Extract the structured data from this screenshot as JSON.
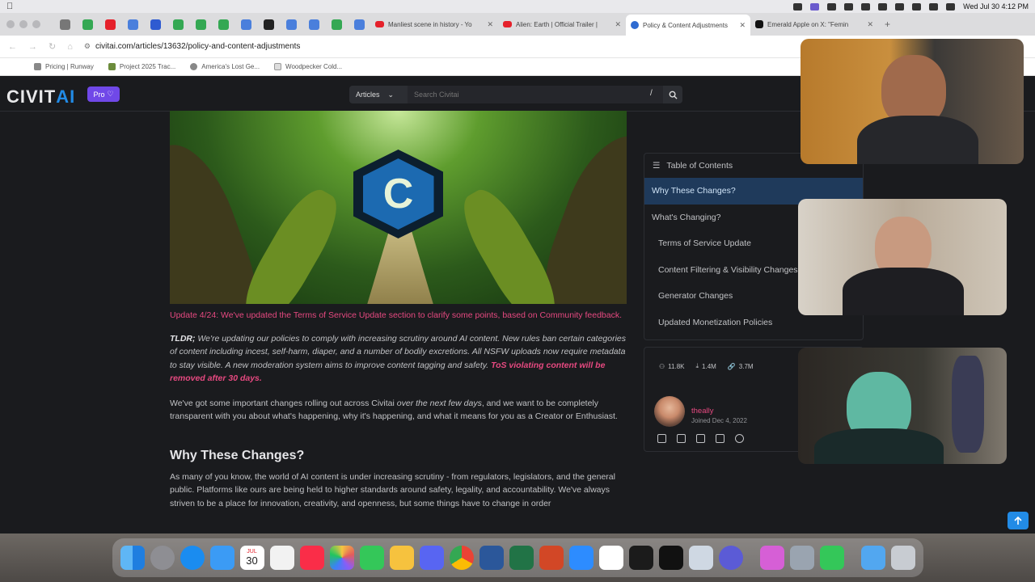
{
  "menubar": {
    "clock": "Wed Jul 30  4:12 PM"
  },
  "tabs": [
    {
      "title": "Manliest scene in history - Yo",
      "favicon_color": "#e5212b"
    },
    {
      "title": "Alien: Earth | Official Trailer |",
      "favicon_color": "#e5212b"
    },
    {
      "title": "Policy & Content Adjustments",
      "favicon_color": "#2f6bd1",
      "active": true
    },
    {
      "title": "Emerald Apple on X: \"Femin",
      "favicon_color": "#111111"
    }
  ],
  "address_bar": {
    "url": "civitai.com/articles/13632/policy-and-content-adjustments"
  },
  "bookmarks": [
    {
      "label": "Pricing | Runway"
    },
    {
      "label": "Project 2025 Trac..."
    },
    {
      "label": "America's Lost Ge..."
    },
    {
      "label": "Woodpecker Cold..."
    }
  ],
  "site": {
    "logo_main": "CIVIT",
    "logo_accent": "AI",
    "pro_label": "Pro",
    "search_category": "Articles",
    "search_placeholder": "Search Civitai",
    "search_shortcut": "/"
  },
  "article": {
    "update_note": "Update 4/24: We've updated the Terms of Service Update section to clarify some points, based on Community feedback.",
    "tldr_label": "TLDR;",
    "tldr_body": " We're updating our policies to comply with increasing scrutiny around AI content. New rules ban certain categories of content including incest, self-harm, diaper, and a number of bodily excretions. All NSFW uploads now require metadata to stay visible. A new moderation system aims to improve content tagging and safety. ",
    "tldr_warning": "ToS violating content will be removed after 30 days.",
    "intro_before": "We've got some important changes rolling out across Civitai ",
    "intro_italic": "over the next few days",
    "intro_after": ", and we want to be completely transparent with you about what's happening, why it's happening, and what it means for you as a Creator or Enthusiast.",
    "heading": "Why These Changes?",
    "paragraph": "As many of you know, the world of AI content is under increasing scrutiny - from regulators, legislators, and the general public. Platforms like ours are being held to higher standards around safety, legality, and accountability. We've always striven to be a place for innovation, creativity, and openness, but some things have to change in order"
  },
  "toc": {
    "title": "Table of Contents",
    "items": [
      {
        "label": "Why These Changes?",
        "active": true
      },
      {
        "label": "What's Changing?"
      },
      {
        "label": "Terms of Service Update",
        "sub": true
      },
      {
        "label": "Content Filtering & Visibility Changes",
        "sub": true
      },
      {
        "label": "Generator Changes",
        "sub": true
      },
      {
        "label": "Updated Monetization Policies",
        "sub": true
      }
    ]
  },
  "author_card": {
    "stats": {
      "followers": "11.8K",
      "downloads": "1.4M",
      "links": "3.7M"
    },
    "username": "theally",
    "joined": "Joined Dec 4, 2022"
  },
  "dock": {
    "calendar_day": "30",
    "calendar_month": "JUL",
    "icons": [
      "finder-icon",
      "system-settings-icon",
      "safari-icon",
      "mail-icon",
      "calendar-icon",
      "news-icon",
      "music-icon",
      "photos-icon",
      "messages-icon",
      "tes-icon",
      "discord-icon",
      "chrome-icon",
      "word-icon",
      "excel-icon",
      "powerpoint-icon",
      "zoom-icon",
      "lexis-icon",
      "live-tv-icon",
      "apple-tv-icon",
      "preview-icon",
      "app-icon",
      "app-icon-2",
      "finder-window-icon",
      "facetime-icon",
      "folder-icon",
      "trash-icon"
    ]
  }
}
